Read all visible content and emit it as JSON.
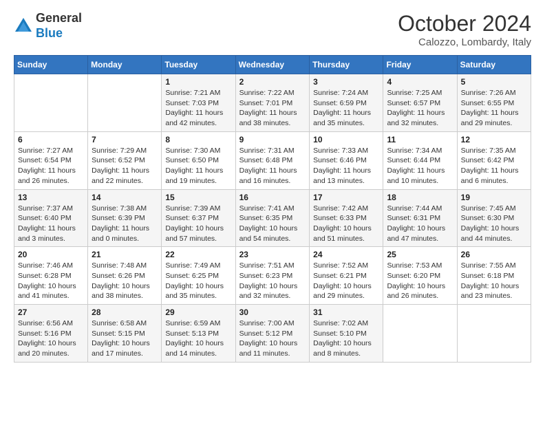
{
  "header": {
    "logo_general": "General",
    "logo_blue": "Blue",
    "month": "October 2024",
    "location": "Calozzo, Lombardy, Italy"
  },
  "weekdays": [
    "Sunday",
    "Monday",
    "Tuesday",
    "Wednesday",
    "Thursday",
    "Friday",
    "Saturday"
  ],
  "weeks": [
    [
      null,
      null,
      {
        "day": "1",
        "sunrise": "Sunrise: 7:21 AM",
        "sunset": "Sunset: 7:03 PM",
        "daylight": "Daylight: 11 hours and 42 minutes."
      },
      {
        "day": "2",
        "sunrise": "Sunrise: 7:22 AM",
        "sunset": "Sunset: 7:01 PM",
        "daylight": "Daylight: 11 hours and 38 minutes."
      },
      {
        "day": "3",
        "sunrise": "Sunrise: 7:24 AM",
        "sunset": "Sunset: 6:59 PM",
        "daylight": "Daylight: 11 hours and 35 minutes."
      },
      {
        "day": "4",
        "sunrise": "Sunrise: 7:25 AM",
        "sunset": "Sunset: 6:57 PM",
        "daylight": "Daylight: 11 hours and 32 minutes."
      },
      {
        "day": "5",
        "sunrise": "Sunrise: 7:26 AM",
        "sunset": "Sunset: 6:55 PM",
        "daylight": "Daylight: 11 hours and 29 minutes."
      }
    ],
    [
      {
        "day": "6",
        "sunrise": "Sunrise: 7:27 AM",
        "sunset": "Sunset: 6:54 PM",
        "daylight": "Daylight: 11 hours and 26 minutes."
      },
      {
        "day": "7",
        "sunrise": "Sunrise: 7:29 AM",
        "sunset": "Sunset: 6:52 PM",
        "daylight": "Daylight: 11 hours and 22 minutes."
      },
      {
        "day": "8",
        "sunrise": "Sunrise: 7:30 AM",
        "sunset": "Sunset: 6:50 PM",
        "daylight": "Daylight: 11 hours and 19 minutes."
      },
      {
        "day": "9",
        "sunrise": "Sunrise: 7:31 AM",
        "sunset": "Sunset: 6:48 PM",
        "daylight": "Daylight: 11 hours and 16 minutes."
      },
      {
        "day": "10",
        "sunrise": "Sunrise: 7:33 AM",
        "sunset": "Sunset: 6:46 PM",
        "daylight": "Daylight: 11 hours and 13 minutes."
      },
      {
        "day": "11",
        "sunrise": "Sunrise: 7:34 AM",
        "sunset": "Sunset: 6:44 PM",
        "daylight": "Daylight: 11 hours and 10 minutes."
      },
      {
        "day": "12",
        "sunrise": "Sunrise: 7:35 AM",
        "sunset": "Sunset: 6:42 PM",
        "daylight": "Daylight: 11 hours and 6 minutes."
      }
    ],
    [
      {
        "day": "13",
        "sunrise": "Sunrise: 7:37 AM",
        "sunset": "Sunset: 6:40 PM",
        "daylight": "Daylight: 11 hours and 3 minutes."
      },
      {
        "day": "14",
        "sunrise": "Sunrise: 7:38 AM",
        "sunset": "Sunset: 6:39 PM",
        "daylight": "Daylight: 11 hours and 0 minutes."
      },
      {
        "day": "15",
        "sunrise": "Sunrise: 7:39 AM",
        "sunset": "Sunset: 6:37 PM",
        "daylight": "Daylight: 10 hours and 57 minutes."
      },
      {
        "day": "16",
        "sunrise": "Sunrise: 7:41 AM",
        "sunset": "Sunset: 6:35 PM",
        "daylight": "Daylight: 10 hours and 54 minutes."
      },
      {
        "day": "17",
        "sunrise": "Sunrise: 7:42 AM",
        "sunset": "Sunset: 6:33 PM",
        "daylight": "Daylight: 10 hours and 51 minutes."
      },
      {
        "day": "18",
        "sunrise": "Sunrise: 7:44 AM",
        "sunset": "Sunset: 6:31 PM",
        "daylight": "Daylight: 10 hours and 47 minutes."
      },
      {
        "day": "19",
        "sunrise": "Sunrise: 7:45 AM",
        "sunset": "Sunset: 6:30 PM",
        "daylight": "Daylight: 10 hours and 44 minutes."
      }
    ],
    [
      {
        "day": "20",
        "sunrise": "Sunrise: 7:46 AM",
        "sunset": "Sunset: 6:28 PM",
        "daylight": "Daylight: 10 hours and 41 minutes."
      },
      {
        "day": "21",
        "sunrise": "Sunrise: 7:48 AM",
        "sunset": "Sunset: 6:26 PM",
        "daylight": "Daylight: 10 hours and 38 minutes."
      },
      {
        "day": "22",
        "sunrise": "Sunrise: 7:49 AM",
        "sunset": "Sunset: 6:25 PM",
        "daylight": "Daylight: 10 hours and 35 minutes."
      },
      {
        "day": "23",
        "sunrise": "Sunrise: 7:51 AM",
        "sunset": "Sunset: 6:23 PM",
        "daylight": "Daylight: 10 hours and 32 minutes."
      },
      {
        "day": "24",
        "sunrise": "Sunrise: 7:52 AM",
        "sunset": "Sunset: 6:21 PM",
        "daylight": "Daylight: 10 hours and 29 minutes."
      },
      {
        "day": "25",
        "sunrise": "Sunrise: 7:53 AM",
        "sunset": "Sunset: 6:20 PM",
        "daylight": "Daylight: 10 hours and 26 minutes."
      },
      {
        "day": "26",
        "sunrise": "Sunrise: 7:55 AM",
        "sunset": "Sunset: 6:18 PM",
        "daylight": "Daylight: 10 hours and 23 minutes."
      }
    ],
    [
      {
        "day": "27",
        "sunrise": "Sunrise: 6:56 AM",
        "sunset": "Sunset: 5:16 PM",
        "daylight": "Daylight: 10 hours and 20 minutes."
      },
      {
        "day": "28",
        "sunrise": "Sunrise: 6:58 AM",
        "sunset": "Sunset: 5:15 PM",
        "daylight": "Daylight: 10 hours and 17 minutes."
      },
      {
        "day": "29",
        "sunrise": "Sunrise: 6:59 AM",
        "sunset": "Sunset: 5:13 PM",
        "daylight": "Daylight: 10 hours and 14 minutes."
      },
      {
        "day": "30",
        "sunrise": "Sunrise: 7:00 AM",
        "sunset": "Sunset: 5:12 PM",
        "daylight": "Daylight: 10 hours and 11 minutes."
      },
      {
        "day": "31",
        "sunrise": "Sunrise: 7:02 AM",
        "sunset": "Sunset: 5:10 PM",
        "daylight": "Daylight: 10 hours and 8 minutes."
      },
      null,
      null
    ]
  ]
}
